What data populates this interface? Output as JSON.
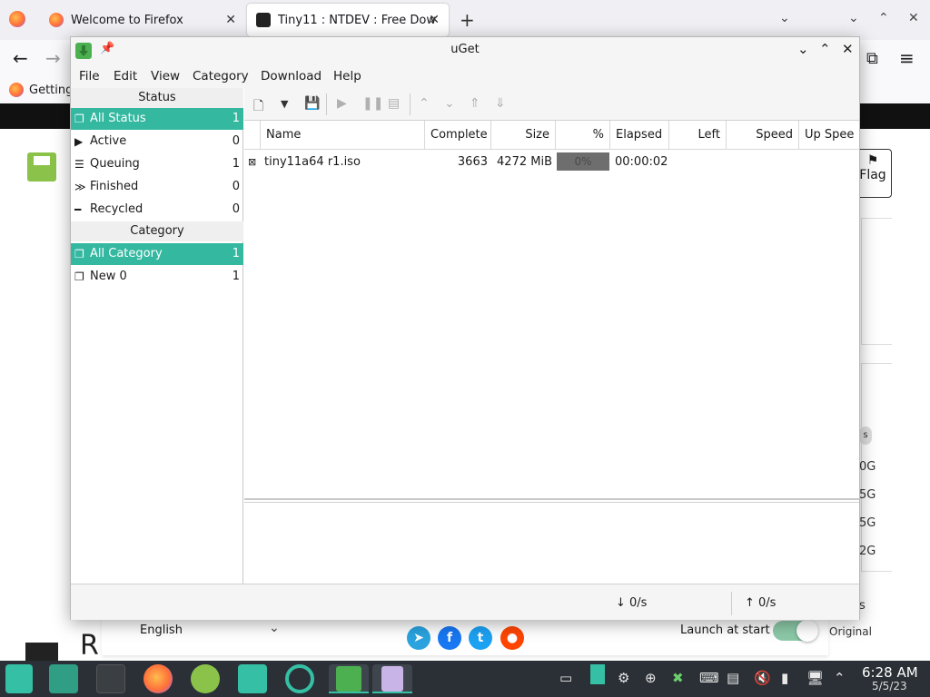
{
  "firefox": {
    "tabs": [
      {
        "title": "Welcome to Firefox"
      },
      {
        "title": "Tiny11 : NTDEV : Free Dow"
      }
    ],
    "bookmark": "Getting",
    "flag_label": "Flag",
    "side_sizes": [
      "0G",
      "5G",
      "5G",
      "2G"
    ],
    "side_s": "s",
    "language": "English",
    "launch_label": "Launch at start",
    "original_label": "Original",
    "big_r": "R"
  },
  "uget": {
    "title": "uGet",
    "menu": [
      "File",
      "Edit",
      "View",
      "Category",
      "Download",
      "Help"
    ],
    "status_header": "Status",
    "status_items": [
      {
        "label": "All Status",
        "count": "1",
        "icon": "all-status-icon"
      },
      {
        "label": "Active",
        "count": "0",
        "icon": "play-icon"
      },
      {
        "label": "Queuing",
        "count": "1",
        "icon": "queue-icon"
      },
      {
        "label": "Finished",
        "count": "0",
        "icon": "finished-icon"
      },
      {
        "label": "Recycled",
        "count": "0",
        "icon": "recycle-icon"
      }
    ],
    "category_header": "Category",
    "category_items": [
      {
        "label": "All Category",
        "count": "1"
      },
      {
        "label": "New 0",
        "count": "1"
      }
    ],
    "columns": [
      "Name",
      "Complete",
      "Size",
      "%",
      "Elapsed",
      "Left",
      "Speed",
      "Up Spee"
    ],
    "rows": [
      {
        "name": "tiny11a64 r1.iso",
        "complete": "3663",
        "size": "4272 MiB",
        "percent": "0%",
        "elapsed": "00:00:02",
        "left": "",
        "speed": "",
        "up_speed": ""
      }
    ],
    "statusbar": {
      "down": "↓ 0/s",
      "up": "↑ 0/s"
    }
  },
  "taskbar": {
    "time": "6:28 AM",
    "date": "5/5/23",
    "accent": "#35bfa4"
  },
  "colors": {
    "selection": "#34b8a0",
    "taskbar_bg": "#2b3036"
  }
}
